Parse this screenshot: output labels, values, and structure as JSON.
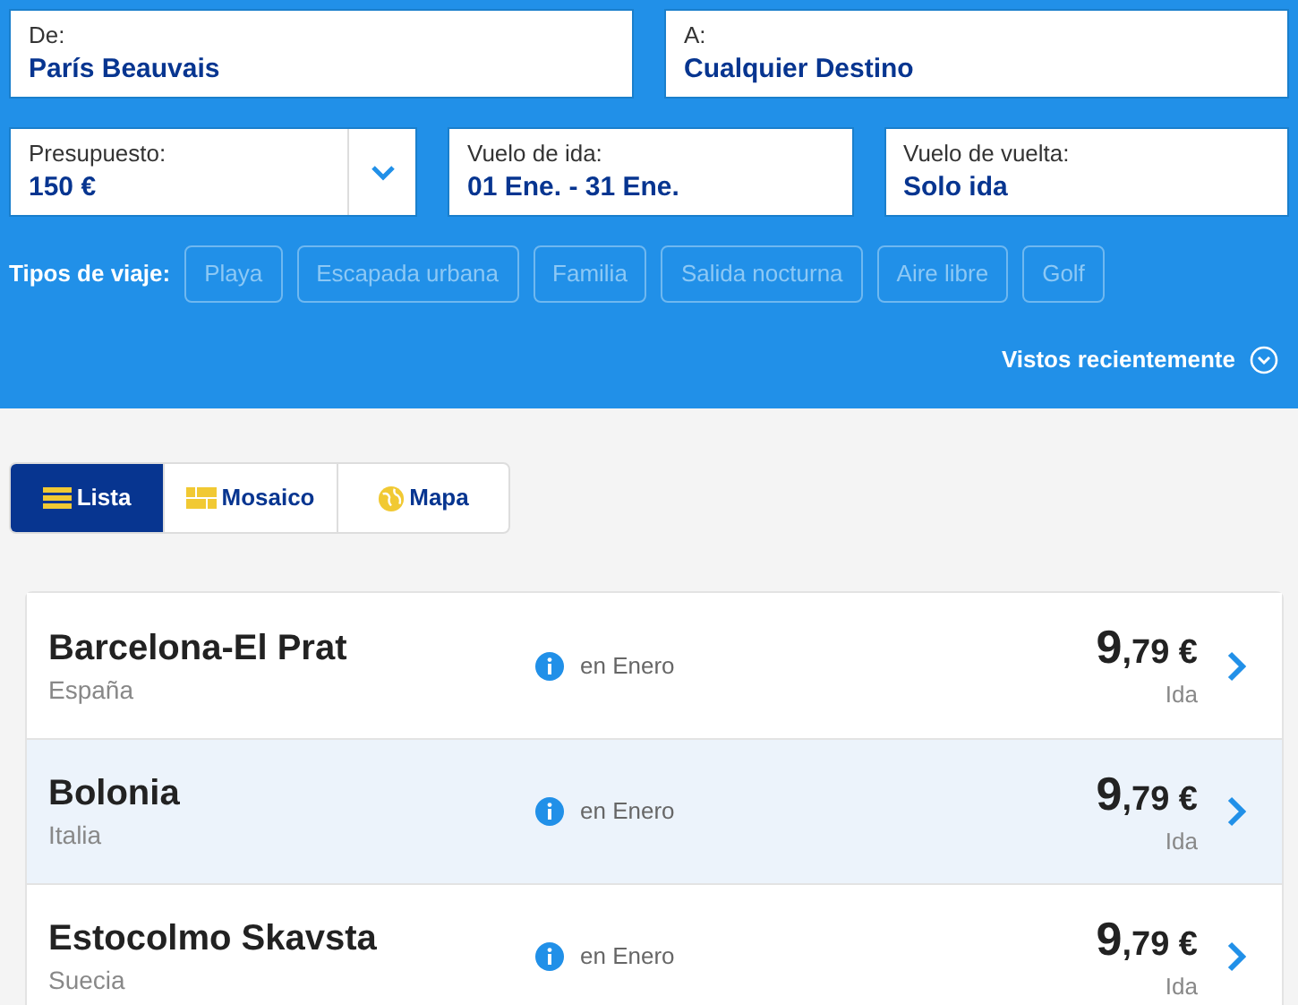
{
  "search": {
    "from": {
      "label": "De:",
      "value": "París Beauvais"
    },
    "to": {
      "label": "A:",
      "value": "Cualquier Destino"
    },
    "budget": {
      "label": "Presupuesto:",
      "value": "150 €"
    },
    "outbound": {
      "label": "Vuelo de ida:",
      "value": "01 Ene. - 31 Ene."
    },
    "return": {
      "label": "Vuelo de vuelta:",
      "value": "Solo ida"
    }
  },
  "trip_types": {
    "label": "Tipos de viaje:",
    "items": [
      {
        "label": "Playa",
        "selected": false
      },
      {
        "label": "Escapada urbana",
        "selected": false
      },
      {
        "label": "Familia",
        "selected": false
      },
      {
        "label": "Salida nocturna",
        "selected": false
      },
      {
        "label": "Aire libre",
        "selected": false
      },
      {
        "label": "Golf",
        "selected": false
      }
    ]
  },
  "recently_viewed": {
    "label": "Vistos recientemente",
    "expanded": false
  },
  "view_tabs": [
    {
      "kind": "list",
      "label": "Lista",
      "selected": true
    },
    {
      "kind": "tiles",
      "label": "Mosaico",
      "selected": false
    },
    {
      "kind": "map",
      "label": "Mapa",
      "selected": false
    }
  ],
  "results": [
    {
      "city": "Barcelona-El Prat",
      "country": "España",
      "period": "en Enero",
      "price_units": "9",
      "price_rest": ",79 €",
      "fare": "Ida",
      "selected": false
    },
    {
      "city": "Bolonia",
      "country": "Italia",
      "period": "en Enero",
      "price_units": "9",
      "price_rest": ",79 €",
      "fare": "Ida",
      "selected": true
    },
    {
      "city": "Estocolmo Skavsta",
      "country": "Suecia",
      "period": "en Enero",
      "price_units": "9",
      "price_rest": ",79 €",
      "fare": "Ida",
      "selected": false
    }
  ]
}
